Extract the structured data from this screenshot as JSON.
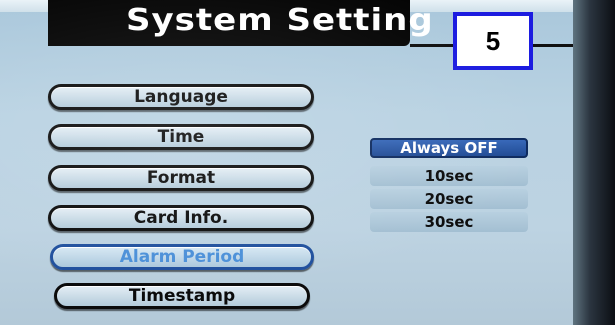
{
  "screen": {
    "title": "System Setting",
    "step_badge": "5"
  },
  "menu": {
    "items": [
      {
        "label": "Language",
        "selected": false
      },
      {
        "label": "Time",
        "selected": false
      },
      {
        "label": "Format",
        "selected": false
      },
      {
        "label": "Card Info.",
        "selected": false
      },
      {
        "label": "Alarm Period",
        "selected": true
      },
      {
        "label": "Timestamp",
        "selected": false
      }
    ]
  },
  "alarm_options": {
    "items": [
      {
        "label": "Always OFF",
        "selected": true
      },
      {
        "label": "10sec",
        "selected": false
      },
      {
        "label": "20sec",
        "selected": false
      },
      {
        "label": "30sec",
        "selected": false
      }
    ]
  },
  "colors": {
    "screen_bg": "#b9d2e2",
    "selected_text": "#4a8fd8",
    "selected_option_bg": "#1f4a94",
    "badge_border": "#1c1ce0"
  }
}
